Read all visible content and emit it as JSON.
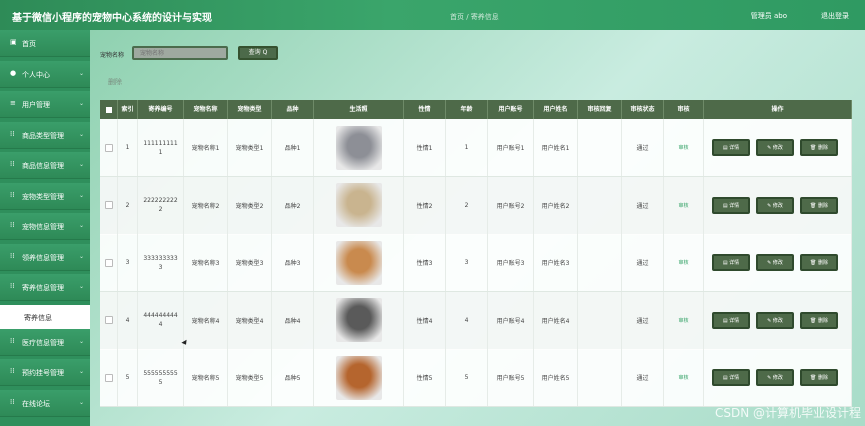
{
  "header": {
    "title": "基于微信小程序的宠物中心系统的设计与实现",
    "breadcrumb": "首页 / 寄养信息",
    "user": "管理员 abo",
    "logout": "退出登录"
  },
  "sidebar": {
    "items": [
      {
        "label": "首页",
        "icon": "home-icon"
      },
      {
        "label": "个人中心",
        "icon": "user-icon"
      },
      {
        "label": "用户管理",
        "icon": "list-icon"
      },
      {
        "label": "商品类型管理",
        "icon": "grid-icon"
      },
      {
        "label": "商品信息管理",
        "icon": "grid-icon"
      },
      {
        "label": "宠物类型管理",
        "icon": "grid-icon"
      },
      {
        "label": "宠物信息管理",
        "icon": "grid-icon"
      },
      {
        "label": "领养信息管理",
        "icon": "grid-icon"
      },
      {
        "label": "寄养信息管理",
        "icon": "grid-icon"
      },
      {
        "label": "医疗信息管理",
        "icon": "grid-icon"
      },
      {
        "label": "预约挂号管理",
        "icon": "grid-icon"
      },
      {
        "label": "在线论坛",
        "icon": "grid-icon"
      }
    ],
    "submenu": "寄养信息"
  },
  "search": {
    "label": "宠物名称",
    "placeholder": "宠物名称",
    "button": "查询 Q",
    "delete": "删除"
  },
  "table": {
    "headers": [
      "",
      "索引",
      "寄养编号",
      "宠物名称",
      "宠物类型",
      "品种",
      "生活照",
      "性情",
      "年龄",
      "用户账号",
      "用户姓名",
      "审核回复",
      "审核状态",
      "审核",
      "操作"
    ],
    "rows": [
      {
        "index": "1",
        "no": "1111111111",
        "name": "宠物名称1",
        "type": "宠物类型1",
        "breed": "品种1",
        "temper": "性情1",
        "age": "1",
        "account": "用户账号1",
        "uname": "用户姓名1",
        "reply": "",
        "status": "通过",
        "review": "审核",
        "photo_color": "#8d8f96"
      },
      {
        "index": "2",
        "no": "2222222222",
        "name": "宠物名称2",
        "type": "宠物类型2",
        "breed": "品种2",
        "temper": "性情2",
        "age": "2",
        "account": "用户账号2",
        "uname": "用户姓名2",
        "reply": "",
        "status": "通过",
        "review": "审核",
        "photo_color": "#c9b48f"
      },
      {
        "index": "3",
        "no": "3333333333",
        "name": "宠物名称3",
        "type": "宠物类型3",
        "breed": "品种3",
        "temper": "性情3",
        "age": "3",
        "account": "用户账号3",
        "uname": "用户姓名3",
        "reply": "",
        "status": "通过",
        "review": "审核",
        "photo_color": "#c98a4e"
      },
      {
        "index": "4",
        "no": "4444444444",
        "name": "宠物名称4",
        "type": "宠物类型4",
        "breed": "品种4",
        "temper": "性情4",
        "age": "4",
        "account": "用户账号4",
        "uname": "用户姓名4",
        "reply": "",
        "status": "通过",
        "review": "审核",
        "photo_color": "#5a5a5a"
      },
      {
        "index": "5",
        "no": "5555555555",
        "name": "宠物名称5",
        "type": "宠物类型5",
        "breed": "品种5",
        "temper": "性情5",
        "age": "5",
        "account": "用户账号5",
        "uname": "用户姓名5",
        "reply": "",
        "status": "通过",
        "review": "审核",
        "photo_color": "#b5652e"
      }
    ],
    "actions": {
      "detail": "▤ 详情",
      "edit": "✎ 修改",
      "delete": "🗑 删除"
    }
  },
  "watermark": "CSDN @计算机毕业设计程"
}
